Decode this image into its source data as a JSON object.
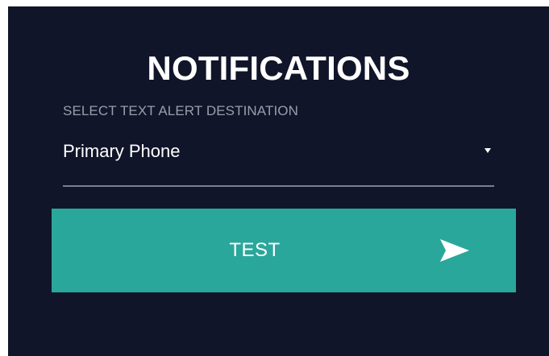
{
  "notifications": {
    "title": "NOTIFICATIONS",
    "destination_label": "SELECT TEXT ALERT DESTINATION",
    "destination_value": "Primary Phone",
    "test_button_label": "TEST",
    "icons": {
      "dropdown": "chevron-down-icon",
      "send": "send-icon"
    },
    "colors": {
      "background": "#11152a",
      "accent": "#2aa79b",
      "text": "#ffffff",
      "muted_text": "#9a9ea9"
    }
  }
}
